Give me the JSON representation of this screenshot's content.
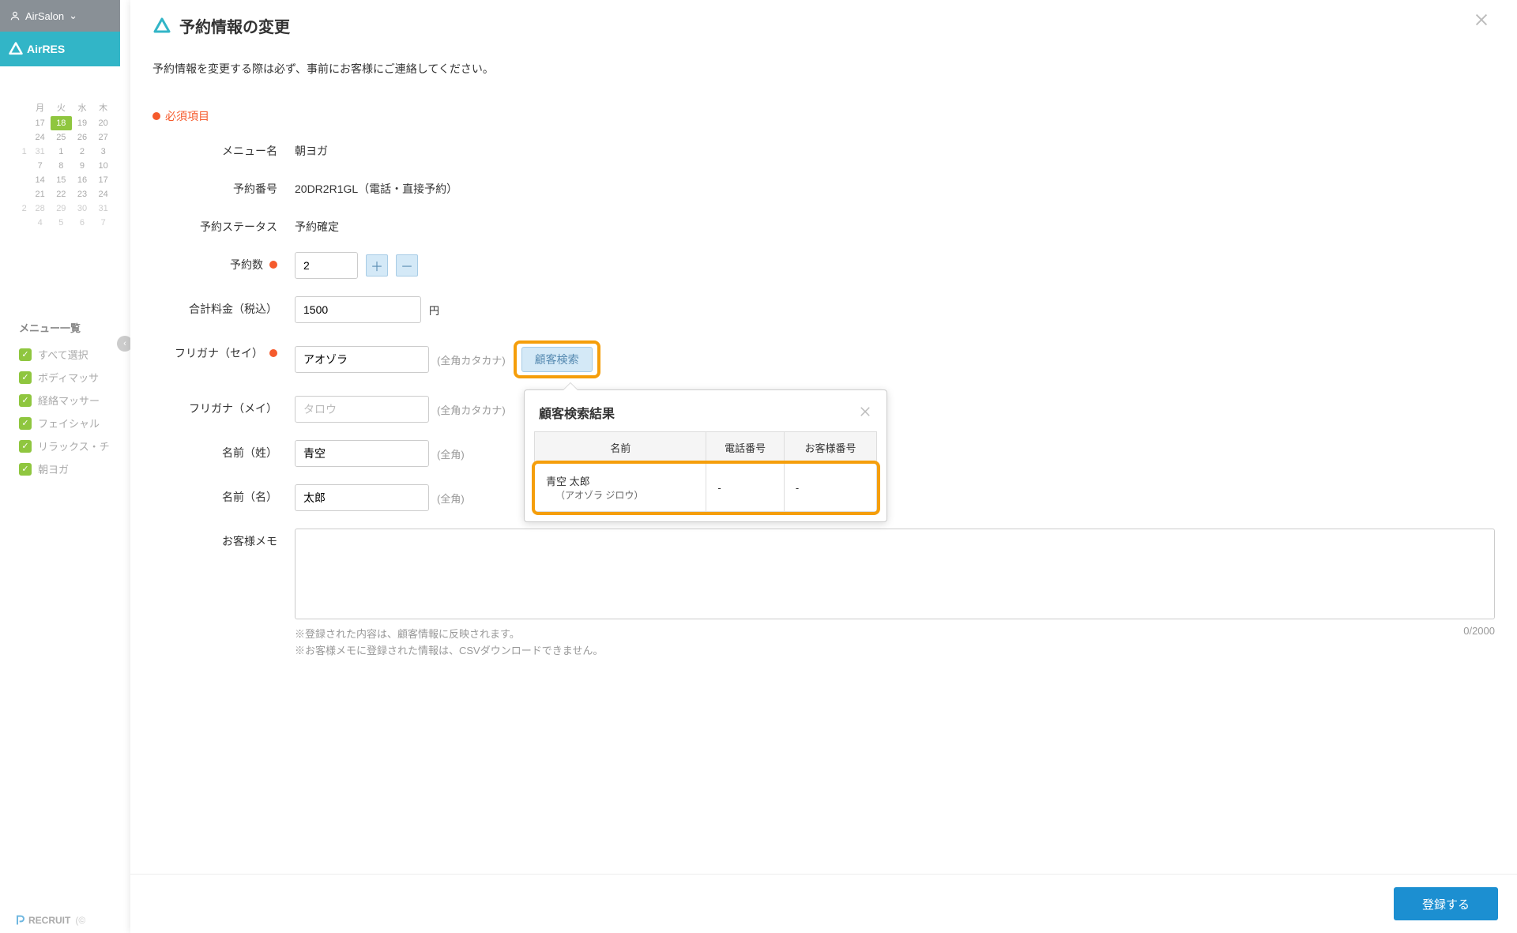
{
  "bg": {
    "salonName": "AirSalon",
    "brand": "AirRES",
    "cal": {
      "wd": [
        "月",
        "火",
        "水",
        "木"
      ],
      "r": [
        [
          "",
          "17",
          "18",
          "19",
          "20"
        ],
        [
          "",
          "24",
          "25",
          "26",
          "27"
        ],
        [
          "1",
          "31",
          "1",
          "2",
          "3"
        ],
        [
          "",
          "7",
          "8",
          "9",
          "10"
        ],
        [
          "",
          "14",
          "15",
          "16",
          "17"
        ],
        [
          "",
          "21",
          "22",
          "23",
          "24"
        ],
        [
          "2",
          "28",
          "29",
          "30",
          "31"
        ],
        [
          "",
          "4",
          "5",
          "6",
          "7"
        ]
      ]
    },
    "menuTitle": "メニュー一覧",
    "menuItems": [
      "すべて選択",
      "ボディマッサ",
      "経絡マッサー",
      "フェイシャル",
      "リラックス・チ",
      "朝ヨガ"
    ],
    "footer": "RECRUIT",
    "footerTail": "(©"
  },
  "modal": {
    "title": "予約情報の変更",
    "note": "予約情報を変更する際は必ず、事前にお客様にご連絡してください。",
    "reqLegend": "必須項目",
    "rows": {
      "menuLabel": "メニュー名",
      "menuValue": "朝ヨガ",
      "resNoLabel": "予約番号",
      "resNoValue": "20DR2R1GL（電話・直接予約）",
      "statusLabel": "予約ステータス",
      "statusValue": "予約確定",
      "countLabel": "予約数",
      "countValue": "2",
      "priceLabel": "合計料金（税込）",
      "priceValue": "1500",
      "priceUnit": "円",
      "kanaSeiLabel": "フリガナ（セイ）",
      "kanaSeiValue": "アオゾラ",
      "kanaHint": "(全角カタカナ)",
      "searchBtn": "顧客検索",
      "kanaMeiLabel": "フリガナ（メイ）",
      "kanaMeiPh": "タロウ",
      "nameSeiLabel": "名前（姓）",
      "nameSeiValue": "青空",
      "nameHint": "(全角)",
      "nameMeiLabel": "名前（名）",
      "nameMeiValue": "太郎",
      "memoLabel": "お客様メモ",
      "memoCounter": "0/2000",
      "memoNote1": "※登録された内容は、顧客情報に反映されます。",
      "memoNote2": "※お客様メモに登録された情報は、CSVダウンロードできません。"
    },
    "popover": {
      "title": "顧客検索結果",
      "cols": [
        "名前",
        "電話番号",
        "お客様番号"
      ],
      "resultName": "青空 太郎",
      "resultKana": "（アオゾラ ジロウ）",
      "resultPhone": "-",
      "resultCustNo": "-"
    },
    "submit": "登録する"
  }
}
